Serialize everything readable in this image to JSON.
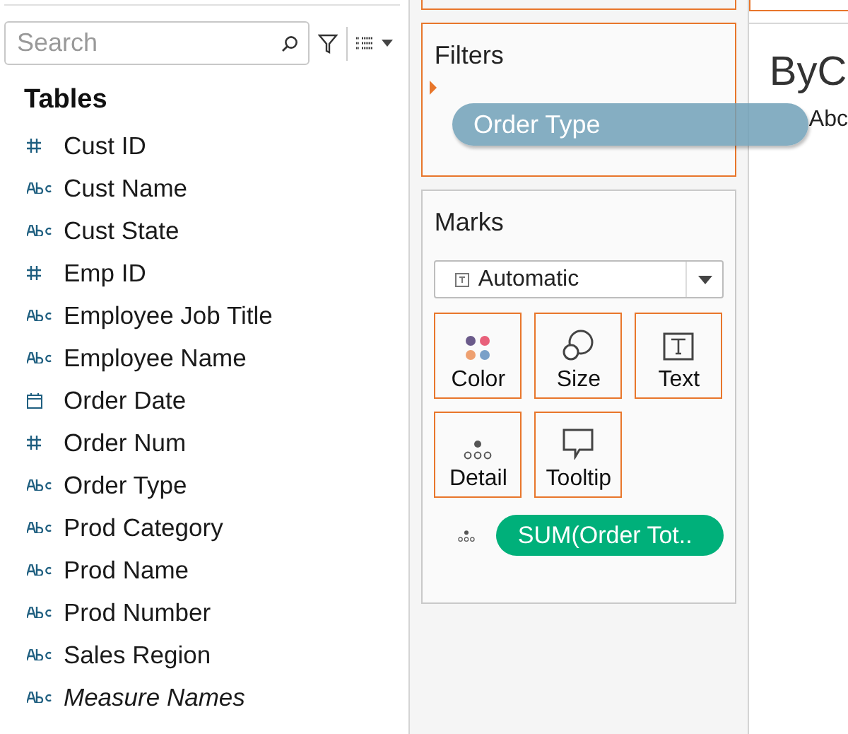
{
  "search": {
    "placeholder": "Search"
  },
  "data_pane": {
    "heading": "Tables",
    "fields": [
      {
        "name": "Cust ID",
        "kind": "number",
        "italic": false
      },
      {
        "name": "Cust Name",
        "kind": "string",
        "italic": false
      },
      {
        "name": "Cust State",
        "kind": "string",
        "italic": false
      },
      {
        "name": "Emp ID",
        "kind": "number",
        "italic": false
      },
      {
        "name": "Employee Job Title",
        "kind": "string",
        "italic": false
      },
      {
        "name": "Employee Name",
        "kind": "string",
        "italic": false
      },
      {
        "name": "Order Date",
        "kind": "date",
        "italic": false
      },
      {
        "name": "Order Num",
        "kind": "number",
        "italic": false
      },
      {
        "name": "Order Type",
        "kind": "string",
        "italic": false
      },
      {
        "name": "Prod Category",
        "kind": "string",
        "italic": false
      },
      {
        "name": "Prod Name",
        "kind": "string",
        "italic": false
      },
      {
        "name": "Prod Number",
        "kind": "string",
        "italic": false
      },
      {
        "name": "Sales Region",
        "kind": "string",
        "italic": false
      },
      {
        "name": "Measure Names",
        "kind": "string",
        "italic": true
      }
    ]
  },
  "filters": {
    "title": "Filters"
  },
  "dragged_pill": {
    "label": "Order Type"
  },
  "marks": {
    "title": "Marks",
    "mark_type": "Automatic",
    "cards": [
      {
        "label": "Color",
        "kind": "color"
      },
      {
        "label": "Size",
        "kind": "size"
      },
      {
        "label": "Text",
        "kind": "text"
      },
      {
        "label": "Detail",
        "kind": "detail"
      },
      {
        "label": "Tooltip",
        "kind": "tooltip"
      }
    ],
    "pills": [
      {
        "label": "SUM(Order Tot..",
        "kind": "detail"
      }
    ]
  },
  "view": {
    "title": "ByC",
    "cell": "Abc"
  }
}
